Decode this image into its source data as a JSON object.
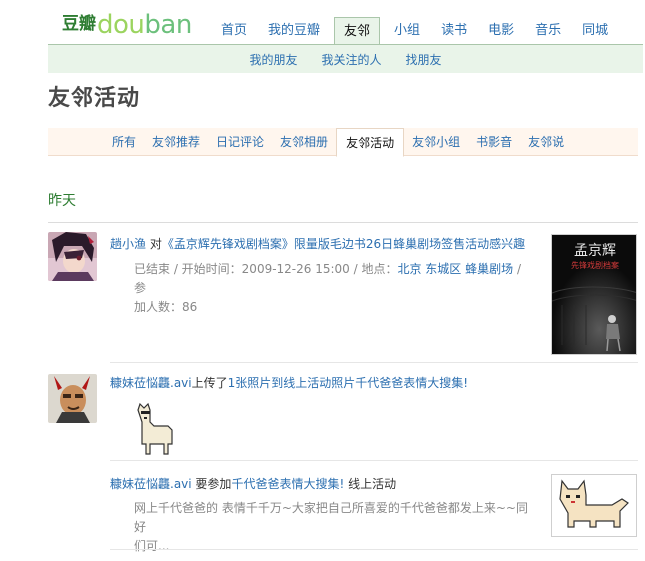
{
  "logo": {
    "cn": "豆瓣",
    "en_a": "dou",
    "en_b": "ban"
  },
  "nav": {
    "items": [
      {
        "label": "首页",
        "active": false
      },
      {
        "label": "我的豆瓣",
        "active": false
      },
      {
        "label": "友邻",
        "active": true
      },
      {
        "label": "小组",
        "active": false
      },
      {
        "label": "读书",
        "active": false
      },
      {
        "label": "电影",
        "active": false
      },
      {
        "label": "音乐",
        "active": false
      },
      {
        "label": "同城",
        "active": false
      }
    ]
  },
  "subnav": {
    "items": [
      "我的朋友",
      "我关注的人",
      "找朋友"
    ]
  },
  "page": {
    "title": "友邻活动"
  },
  "tabs": {
    "items": [
      "所有",
      "友邻推荐",
      "日记评论",
      "友邻相册",
      "友邻活动",
      "友邻小组",
      "书影音",
      "友邻说"
    ],
    "active_index": 4
  },
  "feed": {
    "day_label": "昨天",
    "items": [
      {
        "user": "趟小渔",
        "action": " 对",
        "target": "《孟京辉先锋戏剧档案》限量版毛边书26日蜂巢剧场签售活动感兴趣",
        "meta_line1_a": "已结束 / 开始时间：2009-12-26 15:00 / 地点：",
        "meta_loc": "北京 东城区 蜂巢剧场",
        "meta_line1_b": " / 参",
        "meta_line2": "加人数：86",
        "thumb_title": "孟京辉",
        "thumb_subtitle": "先锋戏剧档案"
      },
      {
        "user": "糠妹莅悩龘.avi",
        "action": "上传了",
        "target": "1张照片到线上活动照片千代爸爸表情大搜集!"
      },
      {
        "user": "糠妹莅悩龘.avi",
        "action": " 要参加",
        "target": "千代爸爸表情大搜集!",
        "tag": " 线上活动",
        "desc_line1": "网上千代爸爸的 表情千千万~大家把自己所喜爱的千代爸爸都发上来~~同好",
        "desc_line2": "们可..."
      }
    ]
  },
  "colors": {
    "link": "#2c6fb0",
    "green": "#2e7d32",
    "nav_bg": "#e9f4e9",
    "tab_bg": "#fff6ee"
  }
}
